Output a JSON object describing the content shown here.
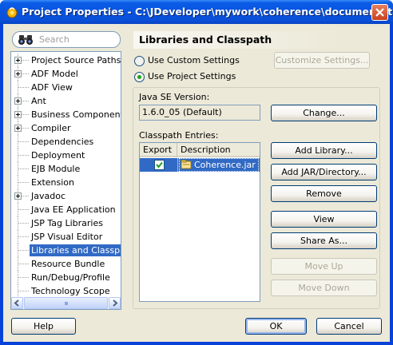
{
  "window": {
    "title": "Project Properties - C:\\JDeveloper\\mywork\\coherence\\documentati..."
  },
  "search": {
    "placeholder": "Search"
  },
  "nav": {
    "items": [
      {
        "label": "Project Source Paths",
        "expandable": true
      },
      {
        "label": "ADF Model",
        "expandable": true
      },
      {
        "label": "ADF View",
        "expandable": false
      },
      {
        "label": "Ant",
        "expandable": true
      },
      {
        "label": "Business Components",
        "expandable": true
      },
      {
        "label": "Compiler",
        "expandable": true
      },
      {
        "label": "Dependencies",
        "expandable": false
      },
      {
        "label": "Deployment",
        "expandable": false
      },
      {
        "label": "EJB Module",
        "expandable": false
      },
      {
        "label": "Extension",
        "expandable": false
      },
      {
        "label": "Javadoc",
        "expandable": true
      },
      {
        "label": "Java EE Application",
        "expandable": false
      },
      {
        "label": "JSP Tag Libraries",
        "expandable": false
      },
      {
        "label": "JSP Visual Editor",
        "expandable": false
      },
      {
        "label": "Libraries and Classpath",
        "expandable": false,
        "selected": true
      },
      {
        "label": "Resource Bundle",
        "expandable": false
      },
      {
        "label": "Run/Debug/Profile",
        "expandable": false
      },
      {
        "label": "Technology Scope",
        "expandable": false
      }
    ]
  },
  "panel": {
    "title": "Libraries and Classpath",
    "use_custom_label": "Use Custom Settings",
    "use_project_label": "Use Project Settings",
    "customize_button": "Customize Settings...",
    "java_se_label": "Java SE Version:",
    "java_se_value": "1.6.0_05 (Default)",
    "change_button": "Change...",
    "classpath_label": "Classpath Entries:",
    "table": {
      "col_export": "Export",
      "col_description": "Description",
      "rows": [
        {
          "export": true,
          "description": "Coherence.jar"
        }
      ]
    },
    "buttons": {
      "add_library": "Add Library...",
      "add_jar": "Add JAR/Directory...",
      "remove": "Remove",
      "view": "View",
      "share_as": "Share As...",
      "move_up": "Move Up",
      "move_down": "Move Down"
    }
  },
  "footer": {
    "help": "Help",
    "ok": "OK",
    "cancel": "Cancel"
  },
  "colors": {
    "title_bar": "#0854e0",
    "selection": "#316ac5",
    "dialog_bg": "#ece9d8"
  }
}
